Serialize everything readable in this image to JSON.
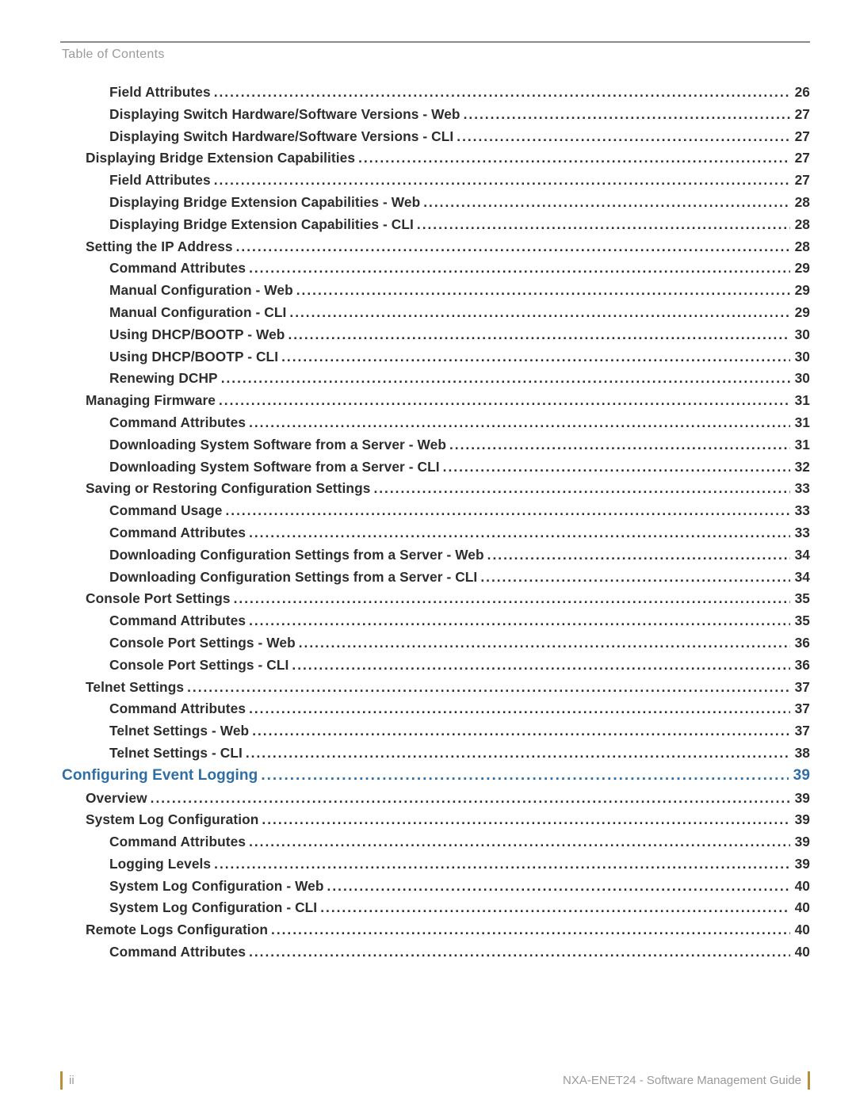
{
  "header": {
    "label": "Table of Contents"
  },
  "toc": [
    {
      "level": 2,
      "title": "Field Attributes",
      "page": "26"
    },
    {
      "level": 2,
      "title": "Displaying Switch Hardware/Software Versions - Web",
      "page": "27"
    },
    {
      "level": 2,
      "title": "Displaying Switch Hardware/Software Versions - CLI",
      "page": "27"
    },
    {
      "level": 1,
      "title": "Displaying Bridge Extension Capabilities",
      "page": "27"
    },
    {
      "level": 2,
      "title": "Field Attributes",
      "page": "27"
    },
    {
      "level": 2,
      "title": "Displaying Bridge Extension Capabilities - Web",
      "page": "28"
    },
    {
      "level": 2,
      "title": "Displaying Bridge Extension Capabilities - CLI",
      "page": "28"
    },
    {
      "level": 1,
      "title": "Setting the IP Address",
      "page": "28"
    },
    {
      "level": 2,
      "title": "Command Attributes",
      "page": "29"
    },
    {
      "level": 2,
      "title": "Manual Configuration - Web",
      "page": "29"
    },
    {
      "level": 2,
      "title": "Manual Configuration - CLI",
      "page": "29"
    },
    {
      "level": 2,
      "title": "Using DHCP/BOOTP - Web",
      "page": "30"
    },
    {
      "level": 2,
      "title": "Using DHCP/BOOTP - CLI",
      "page": "30"
    },
    {
      "level": 2,
      "title": "Renewing DCHP",
      "page": "30"
    },
    {
      "level": 1,
      "title": "Managing Firmware",
      "page": "31"
    },
    {
      "level": 2,
      "title": "Command Attributes",
      "page": "31"
    },
    {
      "level": 2,
      "title": "Downloading System Software from a Server - Web",
      "page": "31"
    },
    {
      "level": 2,
      "title": "Downloading System Software from a Server - CLI",
      "page": "32"
    },
    {
      "level": 1,
      "title": "Saving or Restoring Configuration Settings",
      "page": "33"
    },
    {
      "level": 2,
      "title": "Command Usage",
      "page": "33"
    },
    {
      "level": 2,
      "title": "Command Attributes",
      "page": "33"
    },
    {
      "level": 2,
      "title": "Downloading Configuration Settings from a Server - Web",
      "page": "34"
    },
    {
      "level": 2,
      "title": "Downloading Configuration Settings from a Server - CLI",
      "page": "34"
    },
    {
      "level": 1,
      "title": "Console Port Settings",
      "page": "35"
    },
    {
      "level": 2,
      "title": "Command Attributes",
      "page": "35"
    },
    {
      "level": 2,
      "title": "Console Port Settings - Web",
      "page": "36"
    },
    {
      "level": 2,
      "title": "Console Port Settings - CLI",
      "page": "36"
    },
    {
      "level": 1,
      "title": "Telnet Settings",
      "page": "37"
    },
    {
      "level": 2,
      "title": "Command Attributes",
      "page": "37"
    },
    {
      "level": 2,
      "title": "Telnet Settings - Web",
      "page": "37"
    },
    {
      "level": 2,
      "title": "Telnet Settings - CLI",
      "page": "38"
    },
    {
      "level": 0,
      "title": "Configuring Event Logging",
      "page": "39"
    },
    {
      "level": 1,
      "title": "Overview",
      "page": "39"
    },
    {
      "level": 1,
      "title": "System Log Configuration",
      "page": "39"
    },
    {
      "level": 2,
      "title": "Command Attributes",
      "page": "39"
    },
    {
      "level": 2,
      "title": "Logging Levels",
      "page": "39"
    },
    {
      "level": 2,
      "title": "System Log Configuration - Web",
      "page": "40"
    },
    {
      "level": 2,
      "title": "System Log Configuration - CLI",
      "page": "40"
    },
    {
      "level": 1,
      "title": "Remote Logs Configuration",
      "page": "40"
    },
    {
      "level": 2,
      "title": "Command Attributes",
      "page": "40"
    }
  ],
  "footer": {
    "page_number": "ii",
    "doc_title": "NXA-ENET24 - Software Management Guide"
  }
}
